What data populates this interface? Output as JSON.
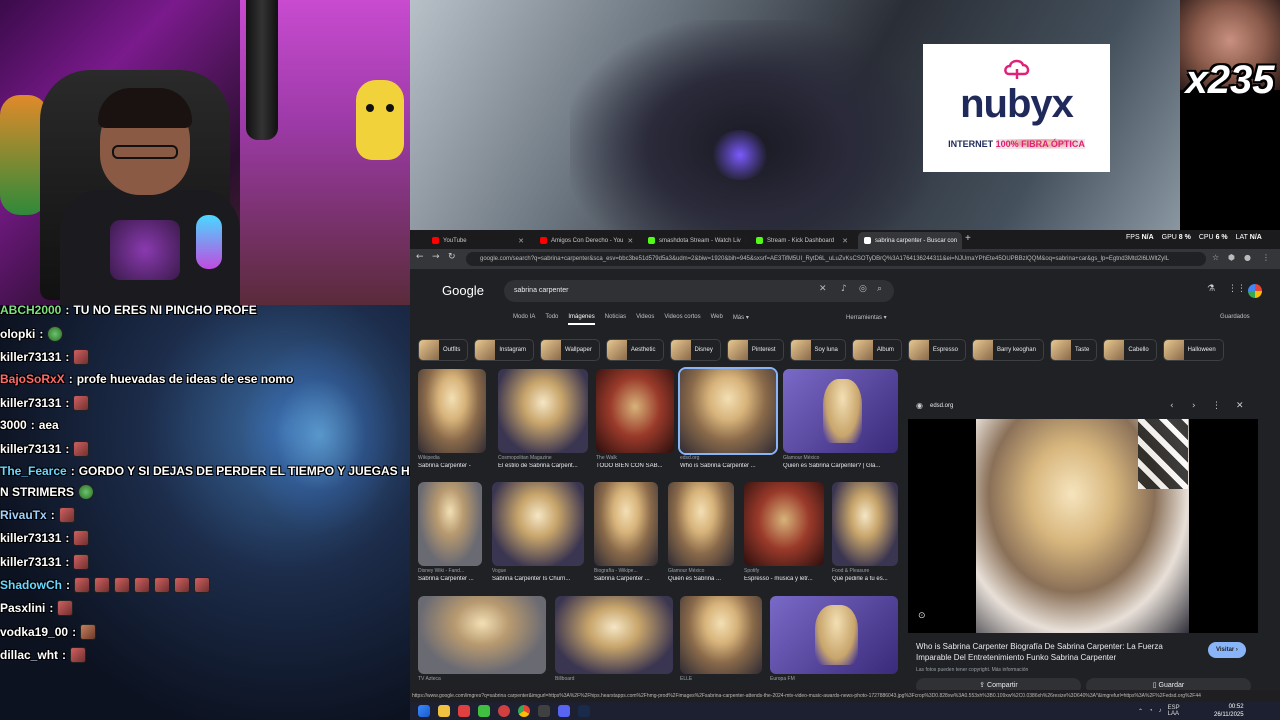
{
  "overlay": {
    "banner_ad": {
      "brand": "nubyx",
      "tagline_start": "INTERNET ",
      "tagline_highlight": "100% FIBRA ÓPTICA"
    },
    "combo_counter": "x235"
  },
  "chat": {
    "messages": [
      {
        "user": "ABCH2000",
        "text": "TU NO ERES NI PINCHO PROFE",
        "user_color": "#7fe07f",
        "emotes": []
      },
      {
        "user": "olopki",
        "text": "",
        "user_color": "#ffffff",
        "emotes": [
          "green"
        ]
      },
      {
        "user": "killer73131",
        "text": "",
        "user_color": "#ffffff",
        "emotes": [
          "red"
        ]
      },
      {
        "user": "BajoSoRxX",
        "text": "profe huevadas de ideas de ese nomo",
        "user_color": "#ff6a6a",
        "emotes": []
      },
      {
        "user": "killer73131",
        "text": "",
        "user_color": "#ffffff",
        "emotes": [
          "red"
        ]
      },
      {
        "user": "3000",
        "text": "aea",
        "user_color": "#ffffff",
        "emotes": []
      },
      {
        "user": "killer73131",
        "text": "",
        "user_color": "#ffffff",
        "emotes": [
          "red"
        ]
      },
      {
        "user": "The_Fearce",
        "text": "GORDO Y SI DEJAS DE PERDER EL TIEMPO Y JUEGAS HAL",
        "user_color": "#6ad7ff",
        "emotes": []
      },
      {
        "user": "N STRIMERS",
        "text": "",
        "user_color": "#ffffff",
        "emotes": [
          "green"
        ],
        "continuation": true
      },
      {
        "user": "RivauTx",
        "text": "",
        "user_color": "#9fd0ff",
        "emotes": [
          "red"
        ]
      },
      {
        "user": "killer73131",
        "text": "",
        "user_color": "#ffffff",
        "emotes": [
          "red"
        ]
      },
      {
        "user": "killer73131",
        "text": "",
        "user_color": "#ffffff",
        "emotes": [
          "red"
        ]
      },
      {
        "user": "ShadowCh",
        "text": "",
        "user_color": "#6ad7ff",
        "emotes": [
          "red",
          "red",
          "red",
          "red",
          "red",
          "red",
          "red"
        ]
      },
      {
        "user": "Pasxlini",
        "text": "",
        "user_color": "#ffffff",
        "emotes": [
          "red"
        ]
      },
      {
        "user": "vodka19_00",
        "text": "",
        "user_color": "#ffffff",
        "emotes": [
          "gray"
        ]
      },
      {
        "user": "dillac_wht",
        "text": "",
        "user_color": "#ffffff",
        "emotes": [
          "red"
        ]
      }
    ]
  },
  "browser": {
    "tabs": [
      {
        "title": "YouTube",
        "fav": "#ff0000",
        "active": false
      },
      {
        "title": "Amigos Con Derecho - You",
        "fav": "#ff0000",
        "active": false
      },
      {
        "title": "smashdota Stream - Watch Liv",
        "fav": "#53fc18",
        "active": false
      },
      {
        "title": "Stream - Kick Dashboard",
        "fav": "#53fc18",
        "active": false
      },
      {
        "title": "sabrina carpenter - Buscar con",
        "fav": "#ffffff",
        "active": true
      }
    ],
    "perf": {
      "fps_label": "FPS",
      "fps_value": "N/A",
      "gpu_label": "GPU",
      "gpu_value": "8 %",
      "cpu_label": "CPU",
      "cpu_value": "6 %",
      "lat_label": "LAT",
      "lat_value": "N/A"
    },
    "url": "google.com/search?q=sabrina+carpenter&sca_esv=bbc3be51d579d5a3&udm=2&biw=1920&bih=945&sxsrf=AE3TifM5UI_RytD6L_uLuZvKsCSOTyDBrQ%3A1764136244311&ei=NJUmaYPhEte45OUPBBzlQQM&oq=sabrina+car&gs_lp=Egtnd3Mtd2l6LWltZyIL",
    "status_url": "https://www.google.com/imgres?q=sabrina carpenter&imgurl=https%3A%2F%2Fhips.hearstapps.com%2Fhmg-prod%2Fimages%2Fsabrina-carpenter-attends-the-2024-mtv-video-music-awards-news-photo-1727886043.jpg%3Fcrop%3D0.828xw%3A0.553xh%3B0.109xw%2C0.0386xh%26resize%3D640%3A*&imgrefurl=https%3A%2F%2Fedsd.org%2F44"
  },
  "google": {
    "logo": "Google",
    "query": "sabrina carpenter",
    "tabs": [
      "Modo IA",
      "Todo",
      "Imágenes",
      "Noticias",
      "Videos",
      "Videos cortos",
      "Web",
      "Más ▾"
    ],
    "active_tab": "Imágenes",
    "tools": "Herramientas ▾",
    "saved": "Guardados",
    "chips": [
      "Outfits",
      "Instagram",
      "Wallpaper",
      "Aesthetic",
      "Disney",
      "Pinterest",
      "Soy luna",
      "Album",
      "Espresso",
      "Barry keoghan",
      "Taste",
      "Cabello",
      "Halloween"
    ],
    "results": [
      {
        "src": "Wikipedia",
        "title": "Sabrina Carpenter -"
      },
      {
        "src": "Cosmopolitan Magazine",
        "title": "El estilo de Sabrina Carpent..."
      },
      {
        "src": "The Walk",
        "title": "TODO BIEN CON SAB..."
      },
      {
        "src": "edsd.org",
        "title": "Who is Sabrina Carpenter ..."
      },
      {
        "src": "Glamour México",
        "title": "Quién es Sabrina Carpenter? | Gla..."
      },
      {
        "src": "Disney Wiki - Fand...",
        "title": "Sabrina Carpenter ..."
      },
      {
        "src": "Vogue",
        "title": "Sabrina Carpenter Is Churn..."
      },
      {
        "src": "Biografía - Wikipe...",
        "title": "Sabrina Carpenter ..."
      },
      {
        "src": "Glamour México",
        "title": "Quién es Sabrina ..."
      },
      {
        "src": "Spotify",
        "title": "Espresso - música y letr..."
      },
      {
        "src": "Food & Pleasure",
        "title": "Qué pedirle a tu es..."
      },
      {
        "src": "TV Azteca",
        "title": ""
      },
      {
        "src": "Billboard",
        "title": ""
      },
      {
        "src": "ELLE",
        "title": ""
      },
      {
        "src": "Europa FM",
        "title": ""
      }
    ],
    "panel": {
      "source": "edsd.org",
      "title": "Who is Sabrina Carpenter Biografía De Sabrina Carpenter: La Fuerza Imparable Del Entretenimiento Funko Sabrina Carpenter",
      "visit": "Visitar ›",
      "copyright": "Las fotos pueden tener copyright. Más información",
      "share": "Compartir",
      "save": "Guardar"
    }
  },
  "taskbar": {
    "lang": "ESP",
    "lang2": "LAA",
    "time": "00:52",
    "date": "26/11/2025"
  }
}
